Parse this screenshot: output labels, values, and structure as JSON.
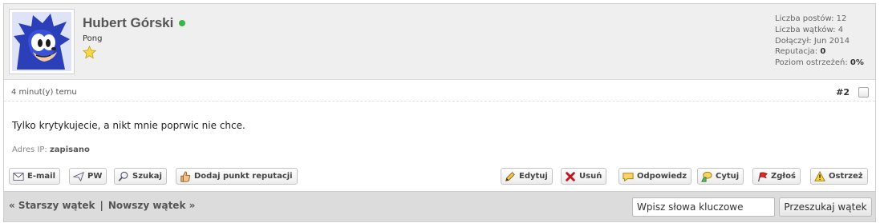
{
  "author": {
    "name": "Hubert Górski",
    "title": "Pong",
    "online_color": "#35b84b"
  },
  "stats": {
    "posts_label": "Liczba postów:",
    "posts": "12",
    "threads_label": "Liczba wątków:",
    "threads": "4",
    "joined_label": "Dołączył:",
    "joined": "Jun 2014",
    "rep_label": "Reputacja:",
    "rep": "0",
    "warn_label": "Poziom ostrzeżeń:",
    "warn": "0%"
  },
  "post": {
    "time": "4 minut(y) temu",
    "number": "#2",
    "message": "Tylko krytykujecie, a nikt mnie poprwic nie chce.",
    "ip_label": "Adres IP:",
    "ip_value": "zapisano"
  },
  "buttons": {
    "email": "E-mail",
    "pm": "PW",
    "find": "Szukaj",
    "rep": "Dodaj punkt reputacji",
    "edit": "Edytuj",
    "delete": "Usuń",
    "reply": "Odpowiedz",
    "quote": "Cytuj",
    "report": "Zgłoś",
    "warn": "Ostrzeż"
  },
  "footer": {
    "older": "« Starszy wątek",
    "separator": "|",
    "newer": "Nowszy wątek »",
    "search_placeholder": "Wpisz słowa kluczowe",
    "search_button": "Przeszukaj wątek"
  }
}
